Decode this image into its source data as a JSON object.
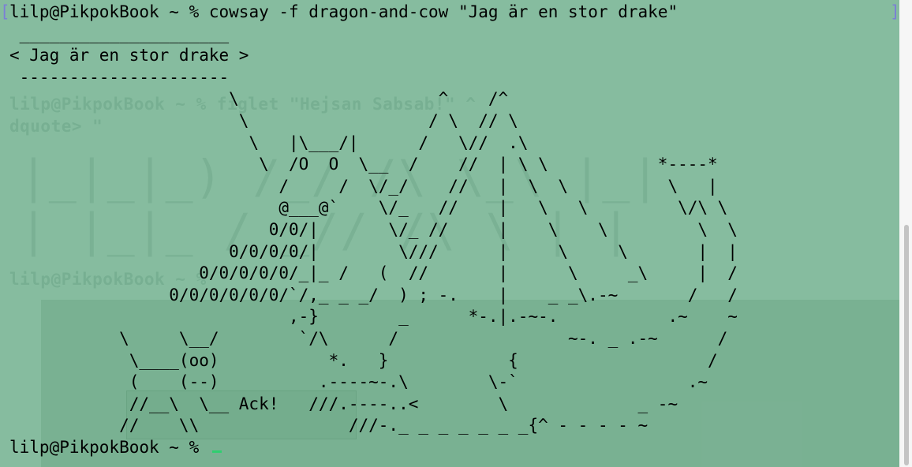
{
  "terminal": {
    "prompt": "lilp@PikpokBook ~ % ",
    "command": "cowsay -f dragon-and-cow \"Jag är en stor drake\"",
    "output": " _____________________\n< Jag är en stor drake >\n ---------------------\n                      \\                    ^    /^\n                       \\                  / \\  // \\\n                        \\   |\\___/|      /   \\//  .\\\n                         \\  /O  O  \\__  /    //  | \\ \\           *----*\n                           /     /  \\/_/    //   |  \\  \\          \\   |\n                           @___@`    \\/_   //    |   \\   \\         \\/\\ \\\n                          0/0/|       \\/_ //     |    \\    \\         \\  \\\n                      0/0/0/0/|        \\///      |     \\     \\       |  |\n                   0/0/0/0/0/_|_ /   (  //       |      \\     _\\     |  /\n                0/0/0/0/0/0/`/,_ _ _/  ) ; -.    |    _ _\\.-~       /   /\n                            ,-}        _      *-.|.-~-.           .~    ~\n           \\     \\__/        `/\\      /                 ~-. _ .-~      /\n            \\____(oo)           *.   }            {                   /\n            (    (--)          .----~-.\\        \\-`                 .~\n            //__\\  \\__ Ack!   ///.----..<        \\             _ -~\n           //    \\\\               ///-._ _ _ _ _ _ _{^ - - - - ~",
    "final_prompt": "lilp@PikpokBook ~ % "
  },
  "background_ghost": {
    "line1": "lilp@PikpokBook ~ % figlet \"Hejsan Sabsab!\" ^",
    "line2": "dquote> \"",
    "line3": "lilp@PikpokBook ~ % "
  },
  "colors": {
    "background": "#86bc9f",
    "cursor": "#2fcf6f",
    "bracket": "#7b7fd6"
  }
}
